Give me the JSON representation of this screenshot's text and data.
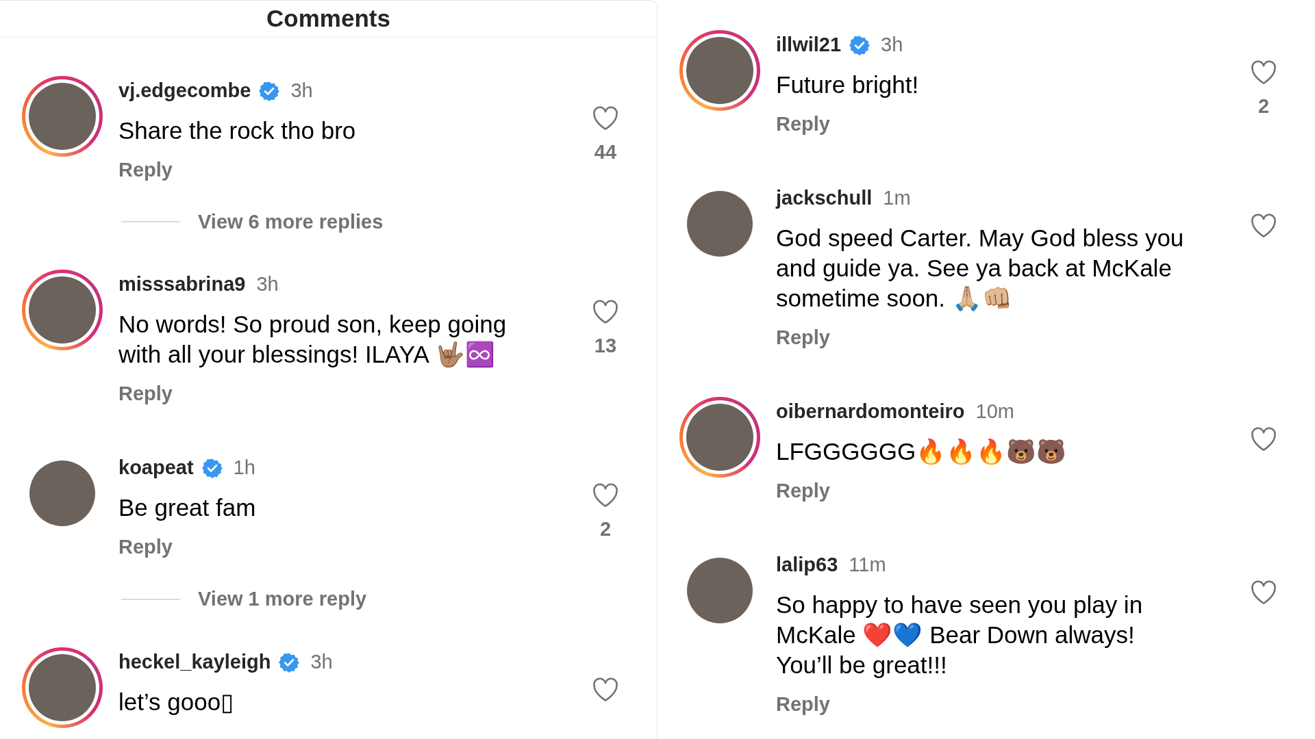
{
  "header": {
    "title": "Comments"
  },
  "columns": [
    {
      "items": [
        {
          "kind": "comment",
          "username": "vj.edgecombe",
          "verified": true,
          "time": "3h",
          "text": "Share the rock tho bro",
          "reply": "Reply",
          "likes": "44",
          "liked": false,
          "story_ring": true
        },
        {
          "kind": "view_replies",
          "label": "View 6 more replies"
        },
        {
          "kind": "comment",
          "username": "misssabrina9",
          "verified": false,
          "time": "3h",
          "text": "No words! So proud son, keep going with all your blessings! ILAYA 🤟🏽♾️",
          "reply": "Reply",
          "likes": "13",
          "liked": false,
          "story_ring": true
        },
        {
          "kind": "comment",
          "username": "koapeat",
          "verified": true,
          "time": "1h",
          "text": "Be great fam",
          "reply": "Reply",
          "likes": "2",
          "liked": false,
          "story_ring": false
        },
        {
          "kind": "view_replies",
          "label": "View 1 more reply"
        },
        {
          "kind": "comment",
          "username": "heckel_kayleigh",
          "verified": true,
          "time": "3h",
          "text": "let’s gooo▯",
          "liked": false,
          "story_ring": true
        }
      ]
    },
    {
      "items": [
        {
          "kind": "comment",
          "username": "illwil21",
          "verified": true,
          "time": "3h",
          "text": "Future bright!",
          "reply": "Reply",
          "likes": "2",
          "liked": false,
          "story_ring": true
        },
        {
          "kind": "comment",
          "username": "jackschull",
          "verified": false,
          "time": "1m",
          "text": "God speed Carter. May God bless you and guide ya. See ya back at McKale sometime soon. 🙏🏼👊🏼",
          "reply": "Reply",
          "liked": false,
          "story_ring": false
        },
        {
          "kind": "comment",
          "username": "oibernardomonteiro",
          "verified": false,
          "time": "10m",
          "text": "LFGGGGGG🔥🔥🔥🐻🐻",
          "reply": "Reply",
          "liked": false,
          "story_ring": true
        },
        {
          "kind": "comment",
          "username": "lalip63",
          "verified": false,
          "time": "11m",
          "text": "So happy to have seen you play in McKale ❤️💙 Bear Down always! You’ll be great!!!",
          "reply": "Reply",
          "liked": false,
          "story_ring": false
        }
      ]
    }
  ]
}
